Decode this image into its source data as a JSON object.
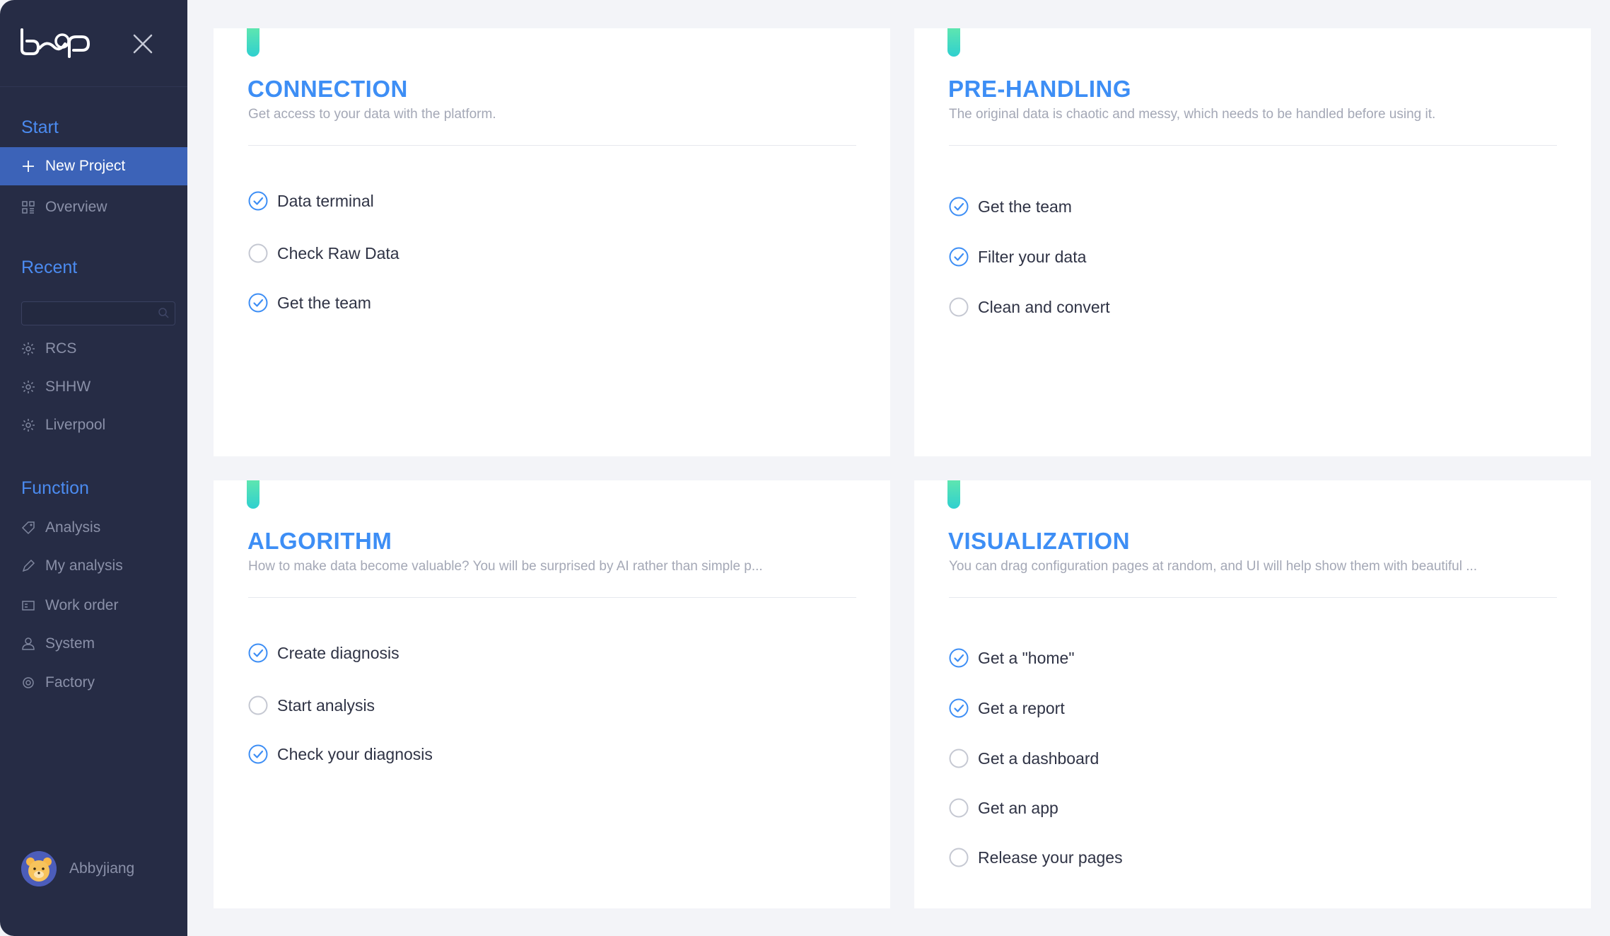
{
  "brand": {
    "logo_text": "bæp"
  },
  "sidebar": {
    "start_title": "Start",
    "start_items": [
      {
        "label": "New Project",
        "icon": "plus-icon",
        "active": true
      },
      {
        "label": "Overview",
        "icon": "grid-icon",
        "active": false
      }
    ],
    "recent_title": "Recent",
    "search": {
      "placeholder": "",
      "value": ""
    },
    "recent_items": [
      {
        "label": "RCS",
        "icon": "gear-icon"
      },
      {
        "label": "SHHW",
        "icon": "gear-icon"
      },
      {
        "label": "Liverpool",
        "icon": "gear-icon"
      }
    ],
    "function_title": "Function",
    "function_items": [
      {
        "label": "Analysis",
        "icon": "tag-icon"
      },
      {
        "label": "My analysis",
        "icon": "pen-icon"
      },
      {
        "label": "Work order",
        "icon": "card-icon"
      },
      {
        "label": "System",
        "icon": "user-icon"
      },
      {
        "label": "Factory",
        "icon": "target-icon"
      }
    ],
    "user": {
      "name": "Abbyjiang",
      "avatar": "bear-avatar"
    }
  },
  "cards": [
    {
      "title": "CONNECTION",
      "desc": "Get access to your data with the platform.",
      "tasks": [
        {
          "label": "Data terminal",
          "done": true
        },
        {
          "label": "Check Raw Data",
          "done": false
        },
        {
          "label": "Get the team",
          "done": true
        }
      ]
    },
    {
      "title": "PRE-HANDLING",
      "desc": "The original data is chaotic and messy, which needs to be handled before using it.",
      "tasks": [
        {
          "label": "Get the team",
          "done": true
        },
        {
          "label": "Filter your data",
          "done": true
        },
        {
          "label": "Clean and convert",
          "done": false
        }
      ]
    },
    {
      "title": "ALGORITHM",
      "desc": "How to make data become valuable? You will be surprised by AI rather than simple p...",
      "tasks": [
        {
          "label": "Create diagnosis",
          "done": true
        },
        {
          "label": "Start analysis",
          "done": false
        },
        {
          "label": "Check your diagnosis",
          "done": true
        }
      ]
    },
    {
      "title": "VISUALIZATION",
      "desc": "You can drag configuration pages at random, and UI will help show them with beautiful ...",
      "tasks": [
        {
          "label": "Get a \"home\"",
          "done": true
        },
        {
          "label": "Get a report",
          "done": true
        },
        {
          "label": "Get a dashboard",
          "done": false
        },
        {
          "label": "Get an app",
          "done": false
        },
        {
          "label": "Release your pages",
          "done": false
        }
      ]
    }
  ],
  "colors": {
    "sidebar_bg": "#262c45",
    "accent": "#3d8ef5",
    "active_item": "#3c63b8",
    "tab_gradient_top": "#5ee6b0",
    "tab_gradient_bottom": "#2fd0cf"
  }
}
